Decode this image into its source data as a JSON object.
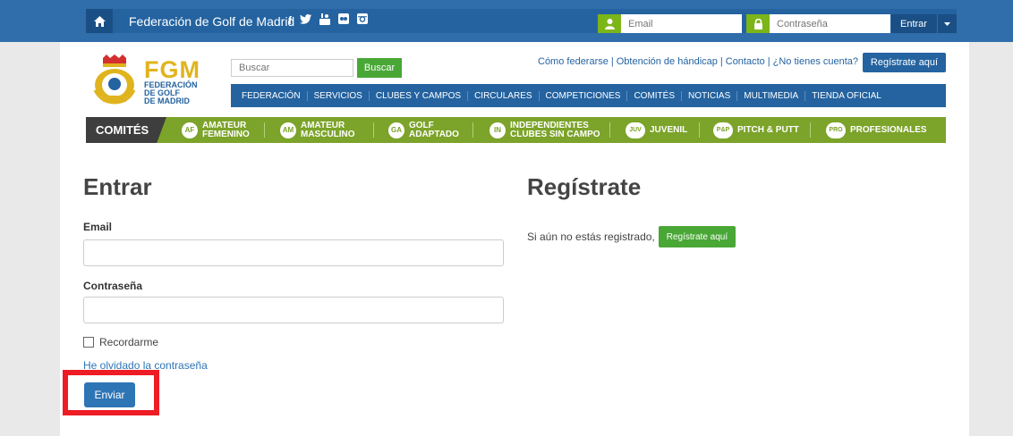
{
  "topbar": {
    "site_title": "Federación de Golf de Madrid",
    "social": [
      "f",
      "y",
      "yt",
      "fl",
      "ig"
    ],
    "email_placeholder": "Email",
    "password_placeholder": "Contraseña",
    "login_label": "Entrar"
  },
  "header": {
    "logo_fgm": "FGM",
    "logo_line1": "FEDERACIÓN",
    "logo_line2": "DE GOLF",
    "logo_line3": "DE MADRID",
    "search_placeholder": "Buscar",
    "search_button": "Buscar",
    "links": [
      "Cómo federarse",
      "Obtención de hándicap",
      "Contacto",
      "¿No tienes cuenta?"
    ],
    "register_button": "Regístrate aquí"
  },
  "mainnav": [
    "FEDERACIÓN",
    "SERVICIOS",
    "CLUBES Y CAMPOS",
    "CIRCULARES",
    "COMPETICIONES",
    "COMITÉS",
    "NOTICIAS",
    "MULTIMEDIA",
    "TIENDA OFICIAL"
  ],
  "committees": {
    "label": "COMITÉS",
    "items": [
      {
        "badge": "AF",
        "line1": "AMATEUR",
        "line2": "FEMENINO"
      },
      {
        "badge": "AM",
        "line1": "AMATEUR",
        "line2": "MASCULINO"
      },
      {
        "badge": "GA",
        "line1": "GOLF",
        "line2": "ADAPTADO"
      },
      {
        "badge": "IN",
        "line1": "INDEPENDIENTES",
        "line2": "CLUBES SIN CAMPO"
      },
      {
        "badge": "JUV",
        "line1": "JUVENIL",
        "line2": ""
      },
      {
        "badge": "P&P",
        "line1": "PITCH & PUTT",
        "line2": ""
      },
      {
        "badge": "PRO",
        "line1": "PROFESIONALES",
        "line2": ""
      }
    ]
  },
  "login": {
    "title": "Entrar",
    "email_label": "Email",
    "password_label": "Contraseña",
    "remember_label": "Recordarme",
    "forgot_link": "He olvidado la contraseña",
    "submit_button": "Enviar"
  },
  "register": {
    "title": "Regístrate",
    "text": "Si aún no estás registrado,",
    "button": "Regístrate aquí"
  },
  "colors": {
    "primary_blue": "#2463a0",
    "green": "#49a736",
    "olive": "#7ca32a",
    "highlight_red": "#ee1c24"
  }
}
